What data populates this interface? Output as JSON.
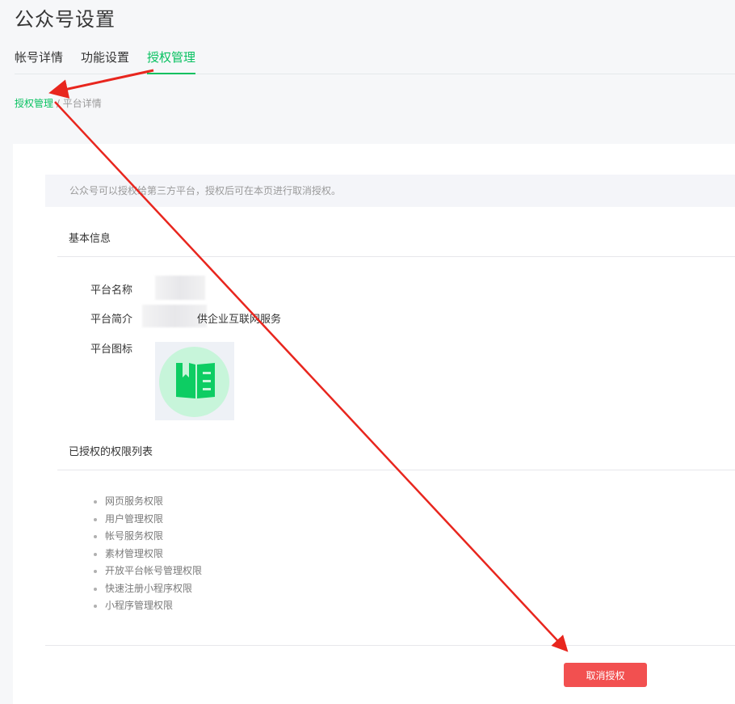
{
  "header": {
    "title": "公众号设置"
  },
  "tabs": [
    {
      "label": "帐号详情"
    },
    {
      "label": "功能设置"
    },
    {
      "label": "授权管理"
    }
  ],
  "breadcrumb": {
    "root": "授权管理",
    "separator": " / ",
    "current": "平台详情"
  },
  "notice": "公众号可以授权给第三方平台，授权后可在本页进行取消授权。",
  "basic_info": {
    "heading": "基本信息",
    "name_label": "平台名称",
    "desc_label": "平台简介",
    "desc_value": "供企业互联网服务",
    "icon_label": "平台图标"
  },
  "permissions": {
    "heading": "已授权的权限列表",
    "items": [
      "网页服务权限",
      "用户管理权限",
      "帐号服务权限",
      "素材管理权限",
      "开放平台帐号管理权限",
      "快速注册小程序权限",
      "小程序管理权限"
    ]
  },
  "actions": {
    "cancel_label": "取消授权"
  },
  "colors": {
    "accent": "#07c160",
    "danger": "#f25050",
    "annotation": "#e8261e",
    "icon_circle": "#c7f5da",
    "icon_fill": "#0dcd63"
  },
  "icons": {
    "platform_icon": "book-icon"
  }
}
